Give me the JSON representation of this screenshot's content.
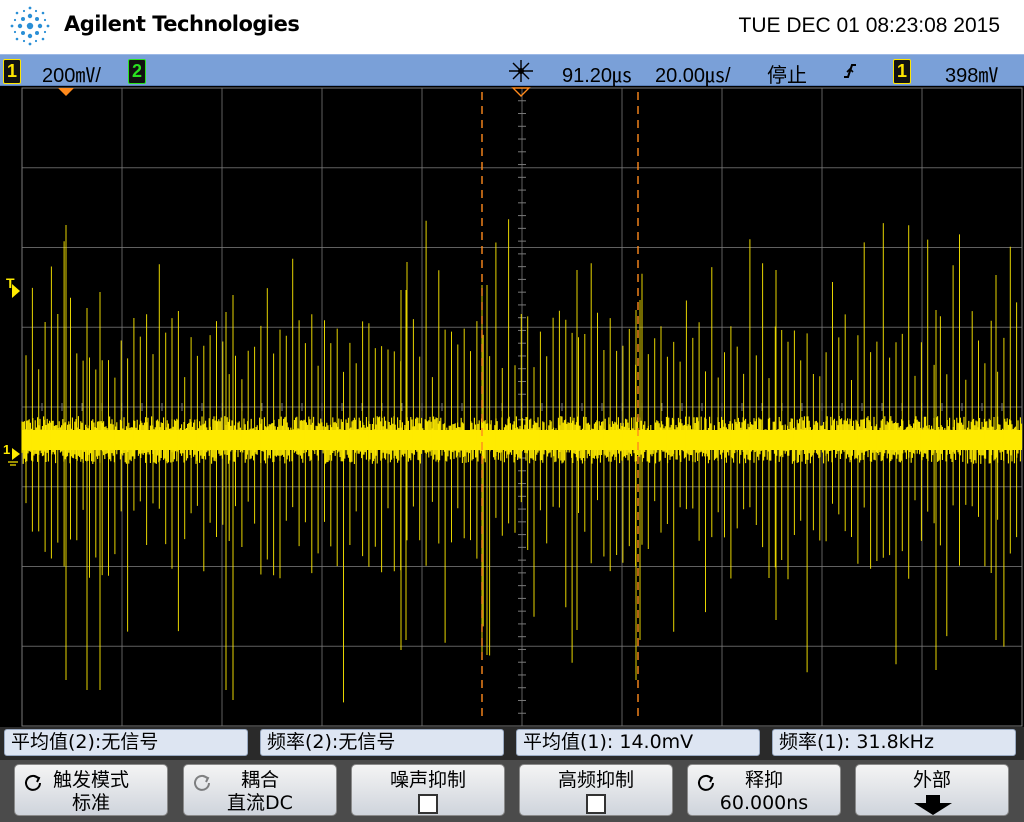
{
  "header": {
    "brand": "Agilent Technologies",
    "datetime": "TUE DEC 01 08:23:08 2015"
  },
  "statusbar": {
    "ch1_badge": "1",
    "ch1_scale": "200㎷/",
    "ch2_badge": "2",
    "time_delay": "91.20㎲",
    "time_scale": "20.00㎲/",
    "run_state": "停止",
    "trigger_edge_symbol": "∱",
    "trigger_channel": "1",
    "trigger_level": "398㎷"
  },
  "screen": {
    "trigger_marker": "T",
    "ch1_ground_marker": "1",
    "colors": {
      "trace": "#ffeb00",
      "cursor": "#ff8a1c",
      "grid": "#7a7a7a",
      "background": "#000000"
    }
  },
  "measurements": [
    {
      "label": "平均值(2):无信号"
    },
    {
      "label": "频率(2):无信号"
    },
    {
      "label": "平均值(1): 14.0mV"
    },
    {
      "label": "频率(1): 31.8kHz"
    }
  ],
  "softkeys": [
    {
      "top": "触发模式",
      "bottom": "标准",
      "icon": "rotate-icon"
    },
    {
      "top": "耦合",
      "bottom": "直流DC",
      "icon": "rotate-icon"
    },
    {
      "top": "噪声抑制",
      "bottom": ""
    },
    {
      "top": "高频抑制",
      "bottom": ""
    },
    {
      "top": "释抑",
      "bottom": "60.000ns",
      "icon": "rotate-icon"
    },
    {
      "top": "外部",
      "bottom": "",
      "icon": "down-arrow-icon"
    }
  ]
}
